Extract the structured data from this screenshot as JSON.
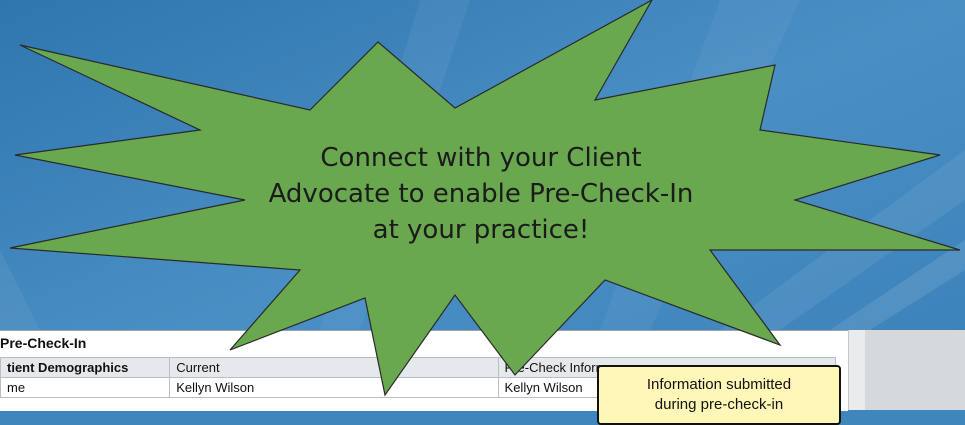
{
  "background": {
    "color": "#3f86bd"
  },
  "panel": {
    "title": "Pre-Check-In",
    "headers": [
      "tient Demographics",
      "Current",
      "Pre-Check Inforr"
    ],
    "rows": [
      [
        "me",
        "Kellyn Wilson",
        "Kellyn Wilson"
      ]
    ]
  },
  "callout": {
    "line1": "Information submitted",
    "line2": "during pre-check-in"
  },
  "starburst": {
    "fill": "#6aa84f",
    "line1": "Connect with your Client",
    "line2": "Advocate to enable Pre-Check-In",
    "line3": "at your practice!"
  }
}
